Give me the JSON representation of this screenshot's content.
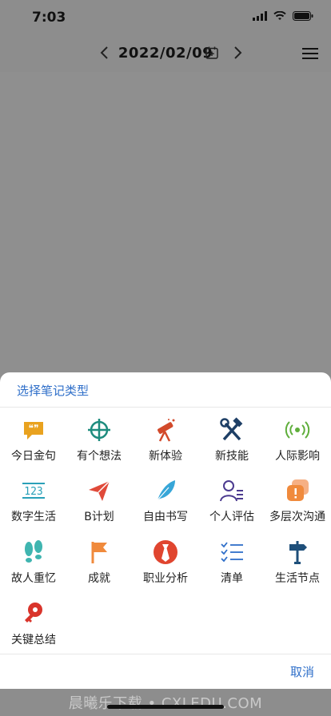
{
  "status": {
    "time": "7:03"
  },
  "nav": {
    "date": "2022/02/09"
  },
  "sheet": {
    "title": "选择笔记类型",
    "cancel": "取消",
    "items": [
      {
        "label": "今日金句",
        "icon": "quote-bubble-icon",
        "color": "#e9a21f"
      },
      {
        "label": "有个想法",
        "icon": "crosshair-icon",
        "color": "#1e8c7e"
      },
      {
        "label": "新体验",
        "icon": "telescope-icon",
        "color": "#d24a2b"
      },
      {
        "label": "新技能",
        "icon": "tools-icon",
        "color": "#1e3f66"
      },
      {
        "label": "人际影响",
        "icon": "broadcast-icon",
        "color": "#5fae3b"
      },
      {
        "label": "数字生活",
        "icon": "digits-icon",
        "color": "#2aa0b8"
      },
      {
        "label": "B计划",
        "icon": "paper-plane-icon",
        "color": "#e04a3a"
      },
      {
        "label": "自由书写",
        "icon": "feather-icon",
        "color": "#37a6d8"
      },
      {
        "label": "个人评估",
        "icon": "person-list-icon",
        "color": "#4b3a8f"
      },
      {
        "label": "多层次沟通",
        "icon": "stacked-chat-icon",
        "color": "#f08a3c"
      },
      {
        "label": "故人重忆",
        "icon": "footprints-icon",
        "color": "#3fb5b0"
      },
      {
        "label": "成就",
        "icon": "flag-icon",
        "color": "#f08a3c"
      },
      {
        "label": "职业分析",
        "icon": "tie-icon",
        "color": "#e0452f"
      },
      {
        "label": "清单",
        "icon": "checklist-icon",
        "color": "#2f6fc9"
      },
      {
        "label": "生活节点",
        "icon": "signpost-icon",
        "color": "#1e4f7a"
      },
      {
        "label": "关键总结",
        "icon": "key-icon",
        "color": "#d9342b"
      }
    ]
  },
  "watermark": "晨曦乐下载 • CXLEDU.COM"
}
